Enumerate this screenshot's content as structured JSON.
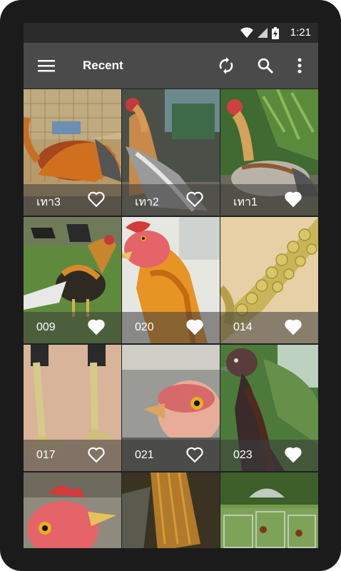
{
  "status_bar": {
    "time": "1:21"
  },
  "app_bar": {
    "title": "Recent"
  },
  "tiles": [
    {
      "label": "เทา3",
      "favorited": false
    },
    {
      "label": "เทา2",
      "favorited": false
    },
    {
      "label": "เทา1",
      "favorited": true
    },
    {
      "label": "009",
      "favorited": true
    },
    {
      "label": "020",
      "favorited": true
    },
    {
      "label": "014",
      "favorited": true
    },
    {
      "label": "017",
      "favorited": false
    },
    {
      "label": "021",
      "favorited": false
    },
    {
      "label": "023",
      "favorited": true
    },
    {
      "label": "",
      "favorited": false
    },
    {
      "label": "",
      "favorited": false
    },
    {
      "label": "",
      "favorited": false
    }
  ]
}
